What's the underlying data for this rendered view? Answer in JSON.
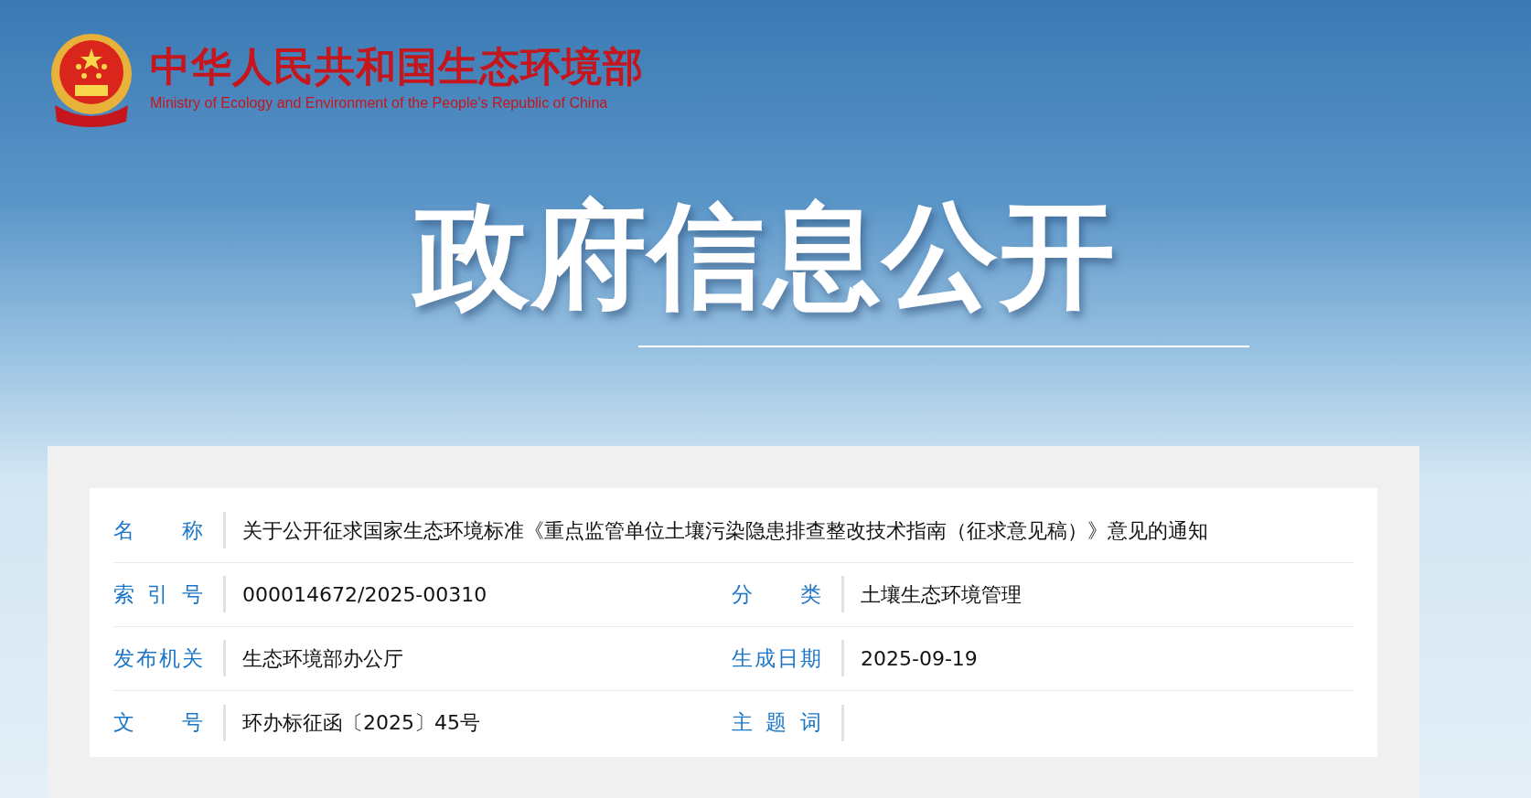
{
  "header": {
    "title": "中华人民共和国生态环境部",
    "subtitle": "Ministry of Ecology and Environment of the People's Republic of China"
  },
  "banner": {
    "title": "政府信息公开"
  },
  "info": {
    "rows": [
      {
        "kind": "full",
        "cells": [
          {
            "label": "名 称",
            "value": "关于公开征求国家生态环境标准《重点监管单位土壤污染隐患排查整改技术指南（征求意见稿）》意见的通知"
          }
        ]
      },
      {
        "kind": "pair",
        "cells": [
          {
            "label": "索 引 号",
            "value": "000014672/2025-00310"
          },
          {
            "label": "分 类",
            "value": "土壤生态环境管理"
          }
        ]
      },
      {
        "kind": "pair",
        "cells": [
          {
            "label": "发布机关",
            "value": "生态环境部办公厅"
          },
          {
            "label": "生成日期",
            "value": "2025-09-19"
          }
        ]
      },
      {
        "kind": "pair",
        "cells": [
          {
            "label": "文 号",
            "value": "环办标征函〔2025〕45号"
          },
          {
            "label": "主 题 词"
          }
        ]
      }
    ]
  }
}
